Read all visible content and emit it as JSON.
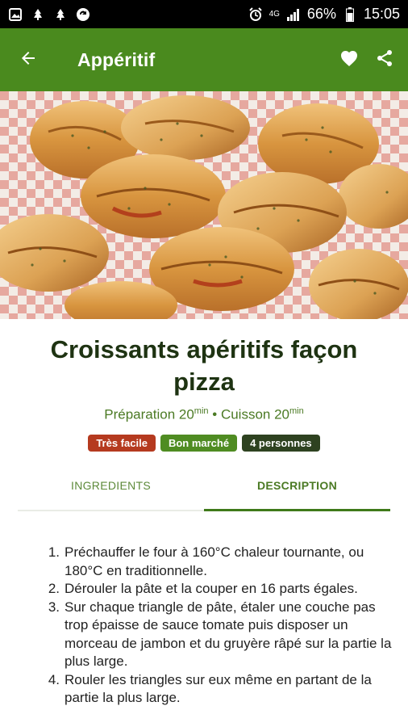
{
  "status_bar": {
    "network": "4G",
    "battery": "66%",
    "time": "15:05"
  },
  "app_bar": {
    "title": "Appéritif"
  },
  "recipe": {
    "title": "Croissants apéritifs façon pizza",
    "prep_label": "Préparation 20",
    "prep_unit": "min",
    "separator": " • ",
    "cook_label": "Cuisson 20",
    "cook_unit": "min",
    "badges": {
      "difficulty": "Très facile",
      "cost": "Bon marché",
      "servings": "4 personnes"
    }
  },
  "tabs": {
    "ingredients": "INGREDIENTS",
    "description": "DESCRIPTION"
  },
  "steps": [
    {
      "num": "1.",
      "text": "Préchauffer le four à 160°C chaleur tournante, ou 180°C en traditionnelle."
    },
    {
      "num": "2.",
      "text": "Dérouler la pâte et la couper en 16 parts égales."
    },
    {
      "num": "3.",
      "text": "Sur chaque triangle de pâte, étaler une couche pas trop épaisse de sauce tomate puis disposer un morceau de jambon et du gruyère râpé sur la partie la plus large."
    },
    {
      "num": "4.",
      "text": "Rouler les triangles sur eux même en partant de la partie la plus large."
    }
  ],
  "colors": {
    "primary": "#4a8a1e",
    "title_text": "#1e3312",
    "badge_easy": "#b53a1f",
    "badge_cheap": "#4f8c22",
    "badge_people": "#2e4220"
  }
}
